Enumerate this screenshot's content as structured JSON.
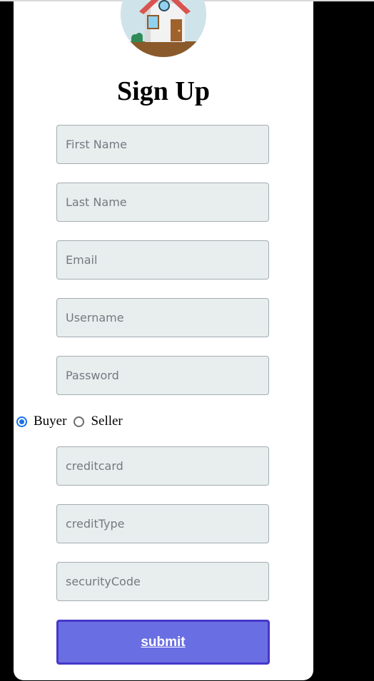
{
  "page": {
    "title": "Sign Up"
  },
  "form": {
    "first_name": {
      "placeholder": "First Name",
      "value": ""
    },
    "last_name": {
      "placeholder": "Last Name",
      "value": ""
    },
    "email": {
      "placeholder": "Email",
      "value": ""
    },
    "username": {
      "placeholder": "Username",
      "value": ""
    },
    "password": {
      "placeholder": "Password",
      "value": ""
    },
    "role": {
      "options": [
        {
          "label": "Buyer",
          "checked": true
        },
        {
          "label": "Seller",
          "checked": false
        }
      ]
    },
    "creditcard": {
      "placeholder": "creditcard",
      "value": ""
    },
    "credit_type": {
      "placeholder": "creditType",
      "value": ""
    },
    "security_code": {
      "placeholder": "securityCode",
      "value": ""
    },
    "submit_label": "submit"
  },
  "colors": {
    "accent_button": "#6a6ee3",
    "button_border": "#4538c8",
    "radio_selected": "#1a73e8",
    "field_background": "#e8edee"
  },
  "icons": {
    "logo": "house-logo-icon"
  }
}
